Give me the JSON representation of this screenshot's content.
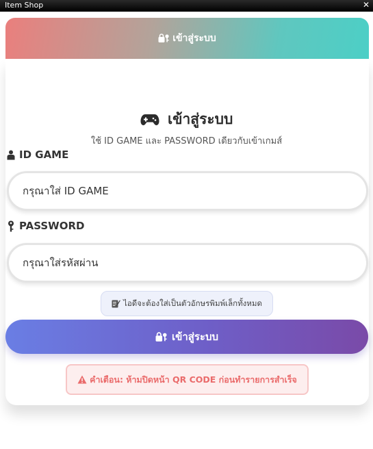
{
  "window": {
    "title": "Item Shop",
    "close_glyph": "✕"
  },
  "header": {
    "label": "เข้าสู่ระบบ",
    "icon": "lock-key-icon",
    "gradient_start": "#ea7f7d",
    "gradient_end": "#4ccfc6"
  },
  "login": {
    "heading": "เข้าสู่ระบบ",
    "heading_icon": "gamepad-icon",
    "subheading": "ใช้ ID GAME และ PASSWORD เดียวกับเข้าเกมส์",
    "id_label": "ID GAME",
    "id_icon": "user-icon",
    "id_placeholder": "กรุณาใส่ ID GAME",
    "password_label": "PASSWORD",
    "password_icon": "key-icon",
    "password_placeholder": "กรุณาใส่รหัสผ่าน",
    "hint": "ไอดีจะต้องใส่เป็นตัวอักษรพิมพ์เล็กทั้งหมด",
    "hint_icon": "memo-icon",
    "submit_label": "เข้าสู่ระบบ",
    "submit_icon": "lock-key-icon",
    "warning": "คำเตือน: ห้ามปิดหน้า QR CODE ก่อนทำรายการสำเร็จ",
    "warning_icon": "warning-icon"
  },
  "colors": {
    "button_start": "#6a7ee4",
    "button_end": "#7a4aa8",
    "warning_text": "#ea6b6b",
    "warning_bg": "#fdeeee"
  }
}
